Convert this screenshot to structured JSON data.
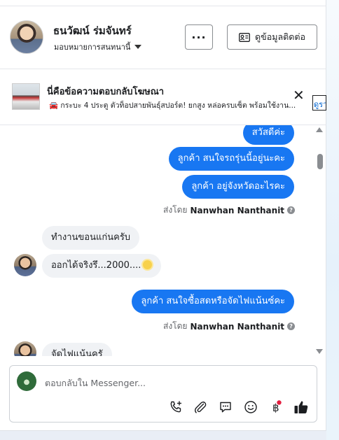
{
  "header": {
    "name": "ธนวัฒน์ ร่มจันทร์",
    "assign_label": "มอบหมายการสนทนานี้",
    "more_label": "···",
    "contact_label": "ดูข้อมูลติดต่อ"
  },
  "ad": {
    "title": "นี่คือข้อความตอบกลับโฆษณา",
    "subtitle": "🚘 กระบะ 4 ประตู ตัวท็อปสายพันธุ์สปอร์ต! ยกสูง หล่อครบเซ็ต พร้อมใช้งาน...",
    "link_label": "ดูรา"
  },
  "messages": [
    {
      "side": "out",
      "text": "สวัสดีค่ะ"
    },
    {
      "side": "out",
      "text": "ลูกค้า  สนใจรถรุ่นนี้อยู่นะคะ"
    },
    {
      "side": "out",
      "text": "ลูกค้า  อยู่จังหวัดอะไรคะ"
    },
    {
      "side": "meta",
      "prefix": "ส่งโดย",
      "sender": "Nanwhan Nanthanit"
    },
    {
      "side": "in",
      "text": "ทำงานขอนแก่นครับ"
    },
    {
      "side": "in",
      "text": "ออกได้จริงรึ...2000...."
    },
    {
      "side": "out",
      "text": "ลูกค้า สนใจซื้อสดหรือจัดไฟแน้นซ์คะ"
    },
    {
      "side": "meta",
      "prefix": "ส่งโดย",
      "sender": "Nanwhan Nanthanit"
    },
    {
      "side": "in",
      "text": "จัดไฟแน้นครั"
    }
  ],
  "composer": {
    "placeholder": "ตอบกลับใน Messenger..."
  },
  "icons": [
    "phone-plus-icon",
    "paperclip-icon",
    "message-bubble-icon",
    "smiley-icon",
    "baht-icon",
    "thumbs-up-icon"
  ],
  "colors": {
    "accent": "#1877f2",
    "incoming": "#f0f2f5",
    "notification": "#e41e3f"
  }
}
